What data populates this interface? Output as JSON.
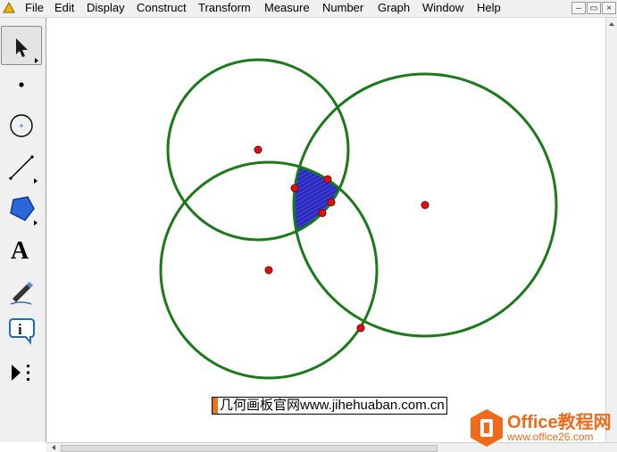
{
  "menu": {
    "items": [
      "File",
      "Edit",
      "Display",
      "Construct",
      "Transform",
      "Measure",
      "Number",
      "Graph",
      "Window",
      "Help"
    ]
  },
  "window_controls": {
    "minimize": "–",
    "restore": "▭",
    "close": "×"
  },
  "toolbox": {
    "tools": [
      {
        "name": "arrow-tool-icon",
        "label": "Arrow"
      },
      {
        "name": "point-tool-icon",
        "label": "Point"
      },
      {
        "name": "compass-tool-icon",
        "label": "Compass"
      },
      {
        "name": "straightedge-tool-icon",
        "label": "Straightedge"
      },
      {
        "name": "polygon-tool-icon",
        "label": "Polygon"
      },
      {
        "name": "text-tool-icon",
        "label": "A"
      },
      {
        "name": "marker-tool-icon",
        "label": "Marker"
      },
      {
        "name": "information-tool-icon",
        "label": "i"
      },
      {
        "name": "custom-tool-icon",
        "label": "Custom"
      }
    ],
    "selected": "Arrow"
  },
  "figure": {
    "circle_color": "#1a7a1a",
    "point_color": "#dd1111",
    "region_fill": "#1a1aa0"
  },
  "caption": {
    "text": "几何画板官网www.jihehuaban.com.cn"
  },
  "watermark": {
    "title": "Office教程网",
    "url": "www.office26.com"
  },
  "colors": {
    "accent": "#ef6a1b",
    "menubar": "#f0f0f0"
  }
}
